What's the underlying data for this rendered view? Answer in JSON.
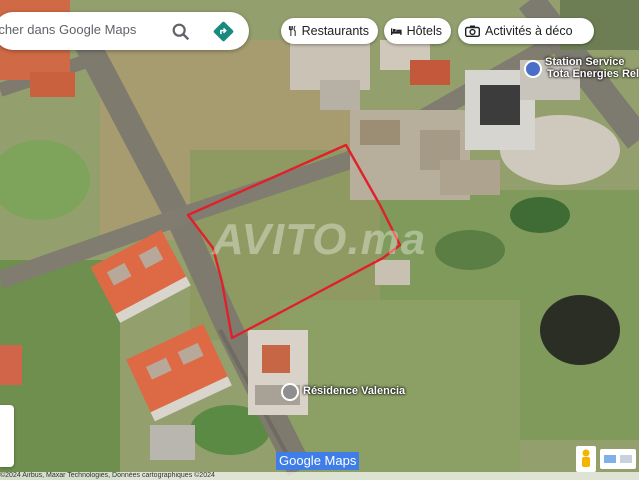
{
  "search": {
    "placeholder": "rcher dans Google Maps"
  },
  "chips": [
    {
      "label": "Restaurants",
      "icon": "fork-knife-icon"
    },
    {
      "label": "Hôtels",
      "icon": "bed-icon"
    },
    {
      "label": "Activités à déco",
      "icon": "camera-icon"
    }
  ],
  "pois": {
    "station": {
      "line1": "Station Service",
      "line2": "Tota Energies Rela",
      "icon": "fuel-station-icon",
      "color": "#4a6fc8"
    },
    "residence": {
      "label": "Résidence Valencia",
      "icon": "building-pin-icon",
      "color": "#8e8e8e"
    }
  },
  "watermark": "AVITO.ma",
  "map": {
    "logo": "Google Maps",
    "attribution": "©2024 Airbus, Maxar Technologies, Données cartographiques ©2024"
  },
  "colors": {
    "outline": "#e0202a",
    "accent": "#1a73e8"
  }
}
